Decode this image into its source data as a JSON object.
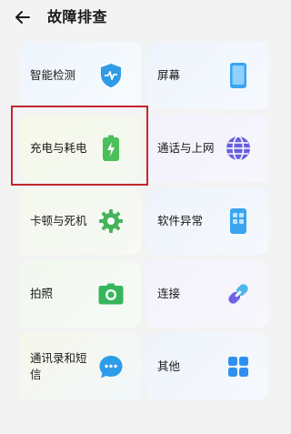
{
  "header": {
    "title": "故障排查"
  },
  "tiles": [
    {
      "label": "智能检测",
      "icon": "shield-pulse-icon"
    },
    {
      "label": "屏幕",
      "icon": "phone-screen-icon"
    },
    {
      "label": "充电与耗电",
      "icon": "battery-charging-icon"
    },
    {
      "label": "通话与上网",
      "icon": "globe-icon"
    },
    {
      "label": "卡顿与死机",
      "icon": "gear-icon"
    },
    {
      "label": "软件异常",
      "icon": "app-grid-phone-icon"
    },
    {
      "label": "拍照",
      "icon": "camera-icon"
    },
    {
      "label": "连接",
      "icon": "link-icon"
    },
    {
      "label": "通讯录和短信",
      "icon": "chat-bubble-icon"
    },
    {
      "label": "其他",
      "icon": "four-squares-icon"
    }
  ],
  "colors": {
    "shield": "#2f9be6",
    "screen": "#3aa4f0",
    "battery": "#4bbf5a",
    "globe": "#6a5fe0",
    "gear": "#46b35a",
    "software": "#3aa4f0",
    "camera": "#37b65c",
    "link": "#6f63e6",
    "chat": "#2d9be8",
    "grid": "#2f8ff0",
    "highlight": "#c2272d"
  }
}
